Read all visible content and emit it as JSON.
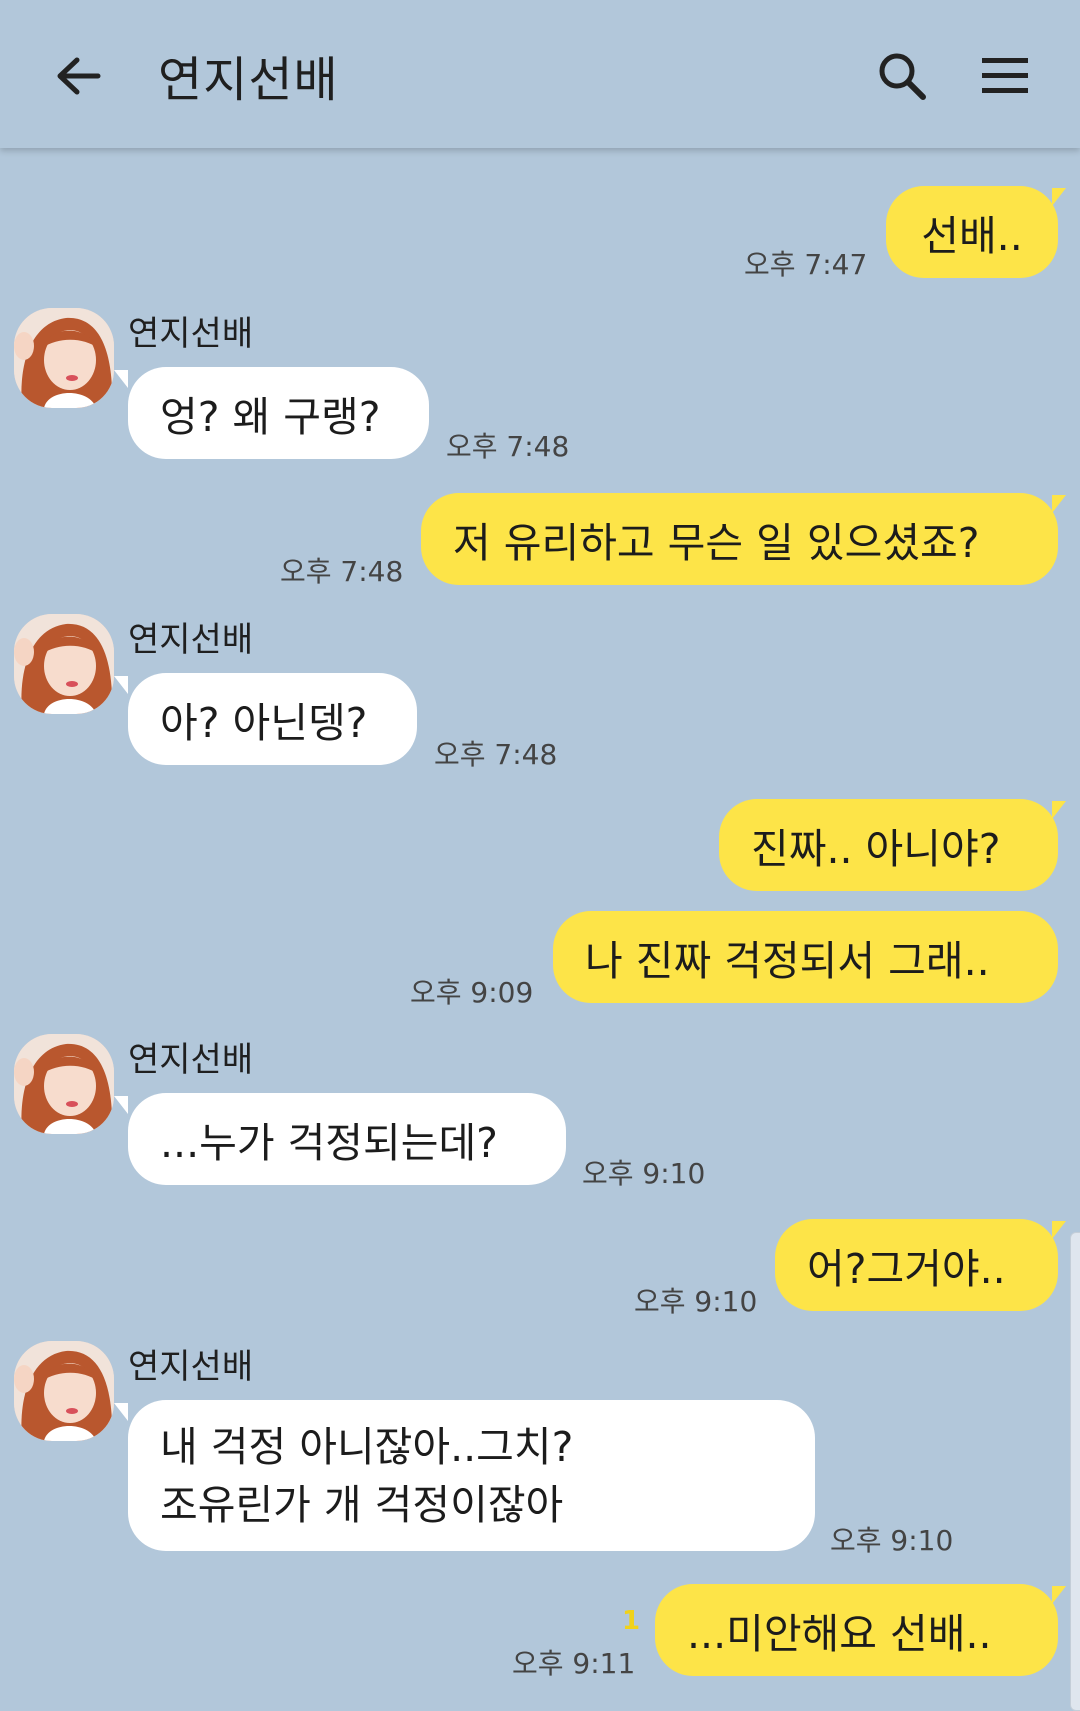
{
  "header": {
    "title": "연지선배",
    "back_icon": "arrow-left-icon",
    "search_icon": "search-icon",
    "menu_icon": "hamburger-menu-icon"
  },
  "colors": {
    "background": "#b2c7da",
    "my_bubble": "#fde448",
    "other_bubble": "#ffffff"
  },
  "messages": [
    {
      "from": "me",
      "text": "선배..",
      "time": "오후 7:47"
    },
    {
      "from": "연지선배",
      "sender": "연지선배",
      "text": "엉? 왜 구랭?",
      "time": "오후 7:48"
    },
    {
      "from": "me",
      "text": "저 유리하고 무슨 일 있으셨죠?",
      "time": "오후 7:48"
    },
    {
      "from": "연지선배",
      "sender": "연지선배",
      "text": "아? 아닌뎅?",
      "time": "오후 7:48"
    },
    {
      "from": "me",
      "text": "진짜.. 아니야?",
      "time": ""
    },
    {
      "from": "me",
      "text": "나 진짜 걱정되서 그래..",
      "time": "오후 9:09"
    },
    {
      "from": "연지선배",
      "sender": "연지선배",
      "text": "...누가 걱정되는데?",
      "time": "오후 9:10"
    },
    {
      "from": "me",
      "text": "어?그거야..",
      "time": "오후 9:10"
    },
    {
      "from": "연지선배",
      "sender": "연지선배",
      "line1": "내 걱정 아니잖아..그치?",
      "line2": "조유린가 개 걱정이잖아",
      "time": "오후 9:10"
    },
    {
      "from": "me",
      "text": "...미안해요 선배..",
      "time": "오후 9:11",
      "unread": "1"
    }
  ]
}
